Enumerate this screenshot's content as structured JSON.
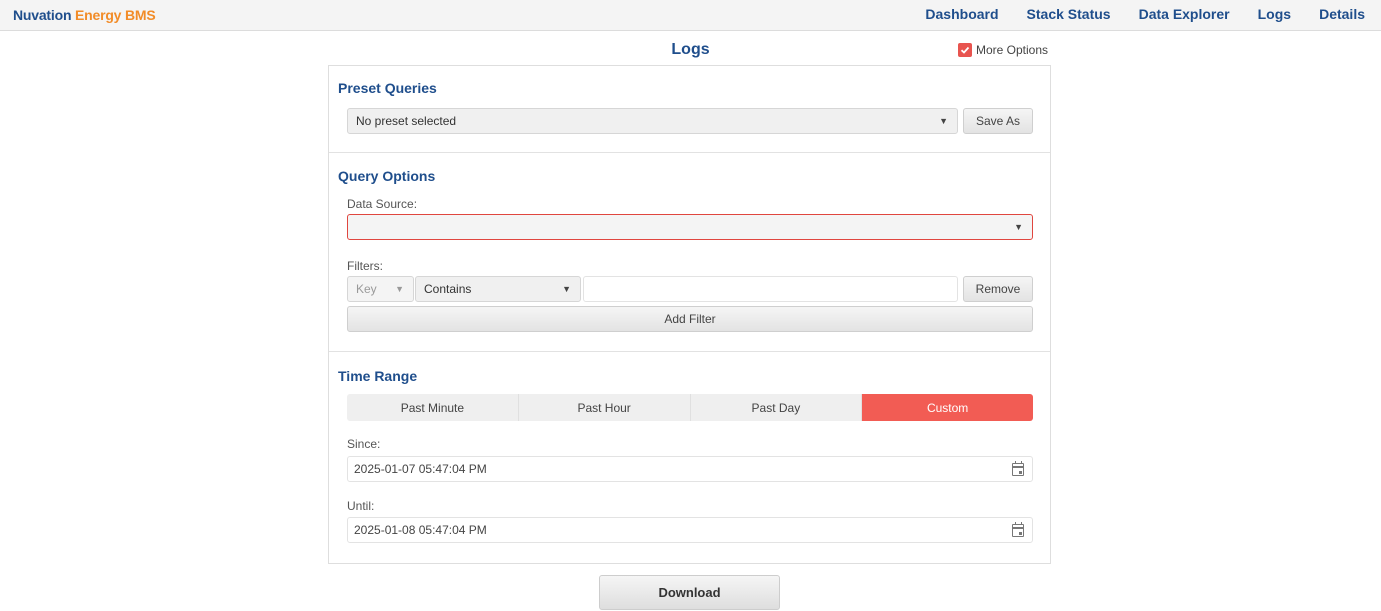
{
  "brand": {
    "part1": "Nuvation",
    "part2": "Energy BMS"
  },
  "nav": [
    "Dashboard",
    "Stack Status",
    "Data Explorer",
    "Logs",
    "Details"
  ],
  "page": {
    "title": "Logs",
    "more_options_label": "More Options",
    "more_options_checked": true
  },
  "preset_queries": {
    "title": "Preset Queries",
    "selected": "No preset selected",
    "save_as_label": "Save As"
  },
  "query_options": {
    "title": "Query Options",
    "data_source_label": "Data Source:",
    "data_source_value": "",
    "filters_label": "Filters:",
    "filter": {
      "key": "Key",
      "operator": "Contains",
      "value": ""
    },
    "remove_label": "Remove",
    "add_filter_label": "Add Filter"
  },
  "time_range": {
    "title": "Time Range",
    "options": [
      "Past Minute",
      "Past Hour",
      "Past Day",
      "Custom"
    ],
    "selected": "Custom",
    "since_label": "Since:",
    "since_value": "2025-01-07 05:47:04 PM",
    "until_label": "Until:",
    "until_value": "2025-01-08 05:47:04 PM"
  },
  "download_label": "Download",
  "colors": {
    "brand_blue": "#1f4e8c",
    "brand_orange": "#f28c28",
    "accent_red": "#f25c54",
    "error_border": "#e0463f"
  }
}
